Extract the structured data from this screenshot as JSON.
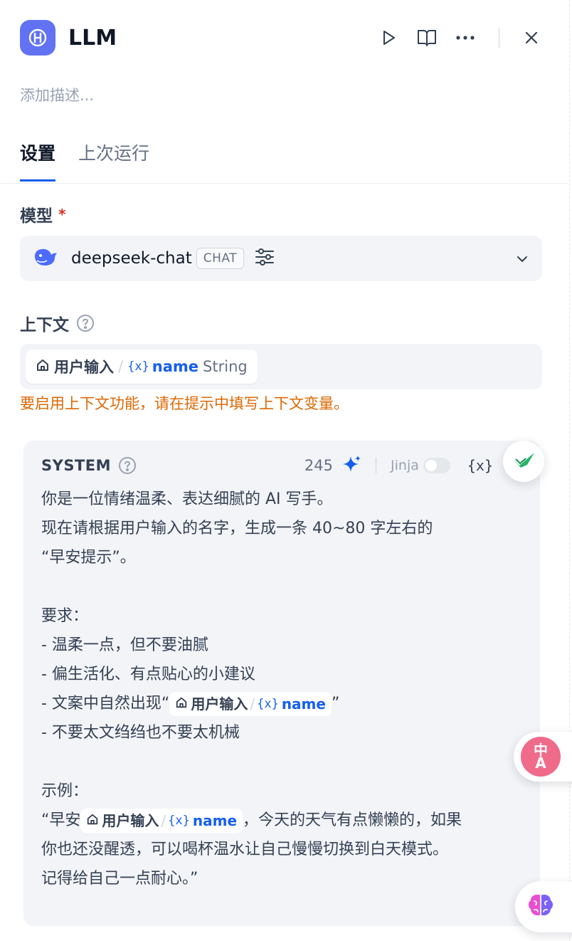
{
  "header": {
    "title": "LLM",
    "description_placeholder": "添加描述..."
  },
  "tabs": [
    {
      "label": "设置",
      "active": true
    },
    {
      "label": "上次运行",
      "active": false
    }
  ],
  "model": {
    "label": "模型",
    "required_mark": "*",
    "name": "deepseek-chat",
    "badge": "CHAT"
  },
  "context": {
    "label": "上下文",
    "chip": {
      "node": "用户输入",
      "separator": "/",
      "var_icon": "{x}",
      "var": "name",
      "type": "String"
    },
    "warning": "要启用上下文功能，请在提示中填写上下文变量。"
  },
  "system": {
    "title": "SYSTEM",
    "count": "245",
    "jinja_label": "Jinja",
    "var_button": "{x}",
    "chip": {
      "node": "用户输入",
      "separator": "/",
      "var_icon": "{x}",
      "var": "name"
    },
    "lines": {
      "l1": "你是一位情绪温柔、表达细腻的 AI 写手。",
      "l2": "现在请根据用户输入的名字，生成一条 40~80 字左右的",
      "l3": "“早安提示”。",
      "l5": "要求：",
      "l6": "- 温柔一点，但不要油腻",
      "l7": "- 偏生活化、有点贴心的小建议",
      "l8_pre": "- 文案中自然出现“",
      "l8_post": "”",
      "l9": "- 不要太文绉绉也不要太机械",
      "l11": "示例：",
      "l12_pre": "“早安",
      "l12_post": "，今天的天气有点懒懒的，如果",
      "l13": "你也还没醒透，可以喝杯温水让自己慢慢切换到白天模式。",
      "l14": "记得给自己一点耐心。”"
    }
  },
  "floating": {
    "translate_glyph_top": "中",
    "translate_glyph_bottom": "A"
  },
  "colors": {
    "accent": "#155eef",
    "app_icon_bg": "#6172f3",
    "warning": "#dc6803",
    "required": "#d92d20"
  }
}
